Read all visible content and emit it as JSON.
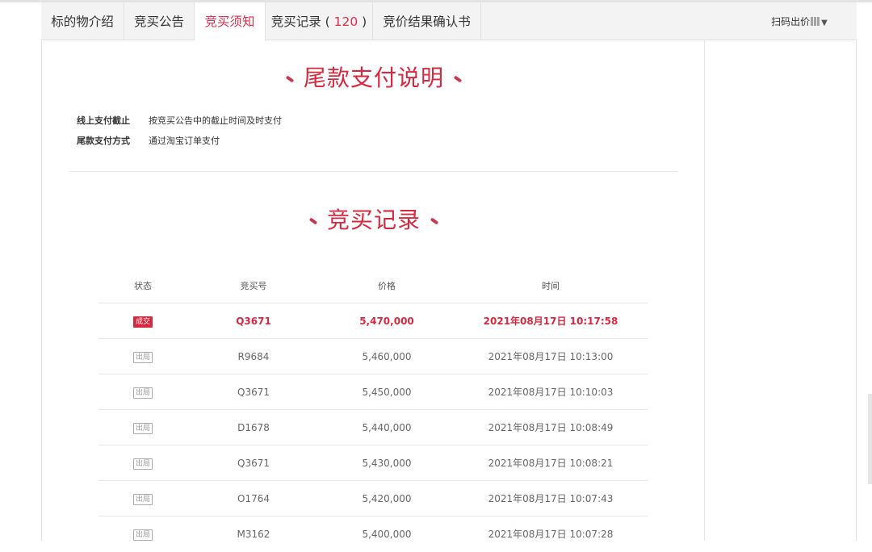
{
  "tabs": [
    {
      "label": "标的物介绍"
    },
    {
      "label": "竞买公告"
    },
    {
      "label": "竞买须知"
    },
    {
      "label": "竞买记录 ( "
    },
    {
      "label": "竞价结果确认书"
    }
  ],
  "record_count": "120",
  "record_tab_suffix": " )",
  "scan_label": "扫码出价",
  "payment": {
    "title": "尾款支付说明",
    "rows": [
      {
        "label": "线上支付截止",
        "value": "按竞买公告中的截止时间及时支付"
      },
      {
        "label": "尾款支付方式",
        "value": "通过淘宝订单支付"
      }
    ]
  },
  "records": {
    "title": "竞买记录",
    "headers": {
      "status": "状态",
      "bid_no": "竞买号",
      "price": "价格",
      "time": "时间"
    },
    "rows": [
      {
        "status": "成交",
        "bid_no": "Q3671",
        "price": "5,470,000",
        "time": "2021年08月17日 10:17:58"
      },
      {
        "status": "出局",
        "bid_no": "R9684",
        "price": "5,460,000",
        "time": "2021年08月17日 10:13:00"
      },
      {
        "status": "出局",
        "bid_no": "Q3671",
        "price": "5,450,000",
        "time": "2021年08月17日 10:10:03"
      },
      {
        "status": "出局",
        "bid_no": "D1678",
        "price": "5,440,000",
        "time": "2021年08月17日 10:08:49"
      },
      {
        "status": "出局",
        "bid_no": "Q3671",
        "price": "5,430,000",
        "time": "2021年08月17日 10:08:21"
      },
      {
        "status": "出局",
        "bid_no": "O1764",
        "price": "5,420,000",
        "time": "2021年08月17日 10:07:43"
      },
      {
        "status": "出局",
        "bid_no": "M3162",
        "price": "5,400,000",
        "time": "2021年08月17日 10:07:28"
      }
    ]
  },
  "colors": {
    "accent": "#d6283e",
    "tab_bg": "#f3f3f3"
  }
}
